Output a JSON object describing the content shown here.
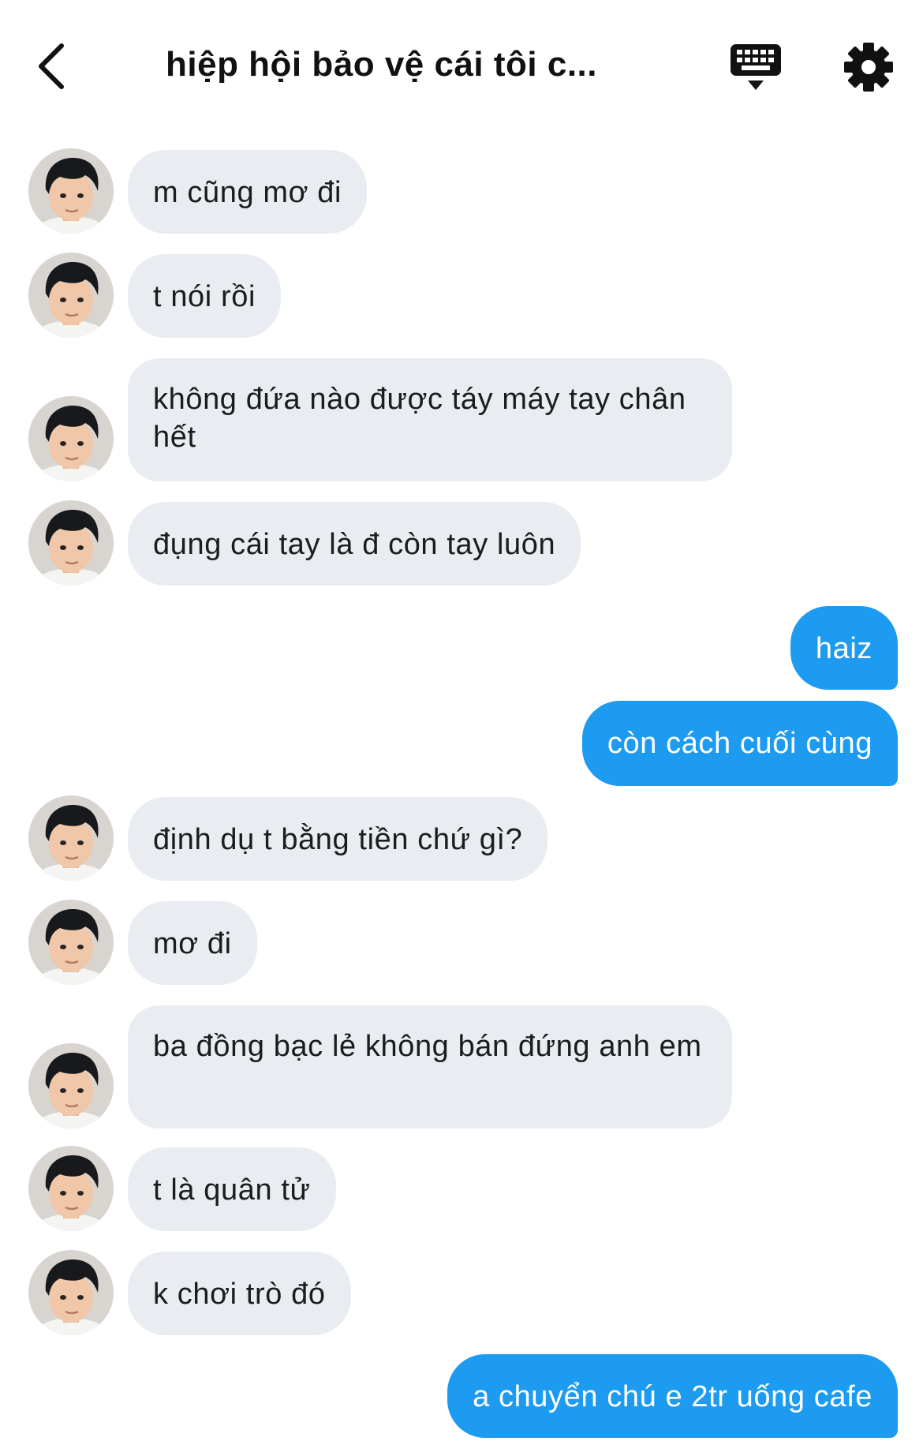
{
  "header": {
    "title": "hiệp hội bảo vệ cái tôi c..."
  },
  "messages": [
    {
      "text": "m cũng mơ đi"
    },
    {
      "text": "t nói rồi"
    },
    {
      "text": "không đứa nào được táy máy tay chân hết"
    },
    {
      "text": "đụng cái tay là đ còn tay luôn"
    },
    {
      "text": "haiz"
    },
    {
      "text": "còn cách cuối cùng"
    },
    {
      "text": "định dụ t bằng tiền chứ gì?"
    },
    {
      "text": "mơ đi"
    },
    {
      "text": "ba đồng bạc lẻ không bán đứng anh em"
    },
    {
      "text": "t là quân tử"
    },
    {
      "text": "k chơi trò đó"
    },
    {
      "text": "a chuyển chú e 2tr uống cafe"
    }
  ],
  "colors": {
    "outgoing_bubble": "#1d9bf0",
    "incoming_bubble": "#e9ecf0"
  },
  "icons": {
    "back": "chevron-left-icon",
    "keyboard": "keyboard-icon",
    "settings": "gear-icon",
    "avatar": "avatar-photo"
  }
}
